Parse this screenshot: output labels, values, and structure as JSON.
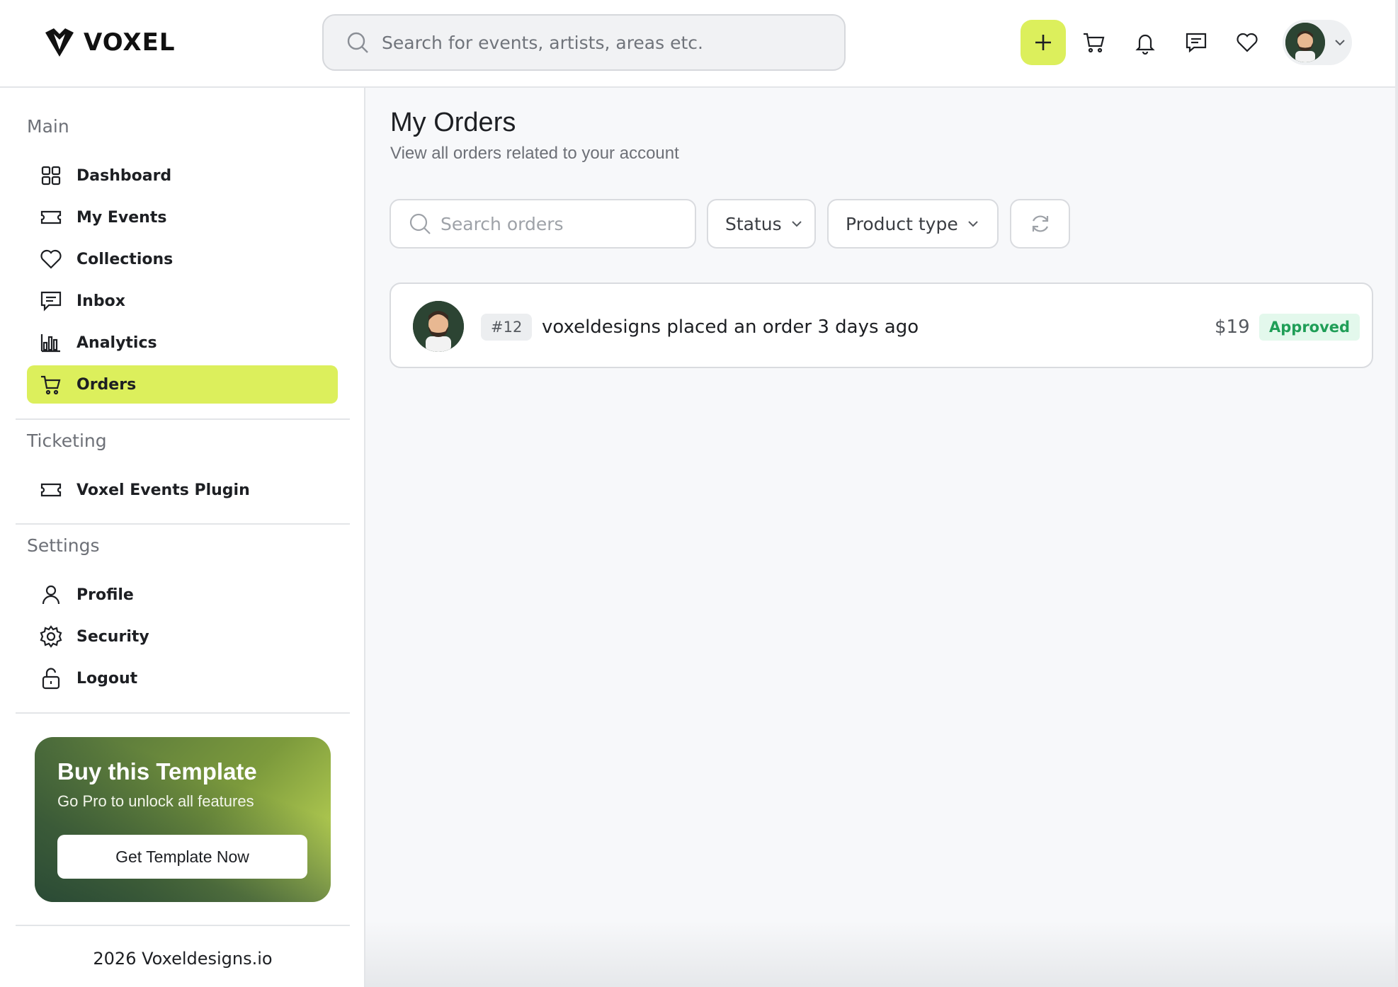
{
  "brand": {
    "name": "VOXEL"
  },
  "header": {
    "search_placeholder": "Search for events, artists, areas etc."
  },
  "sidebar": {
    "sections": {
      "main": "Main",
      "ticketing": "Ticketing",
      "settings": "Settings"
    },
    "main_items": [
      {
        "label": "Dashboard",
        "icon": "grid-icon"
      },
      {
        "label": "My Events",
        "icon": "ticket-icon"
      },
      {
        "label": "Collections",
        "icon": "heart-icon"
      },
      {
        "label": "Inbox",
        "icon": "message-icon"
      },
      {
        "label": "Analytics",
        "icon": "bar-chart-icon"
      },
      {
        "label": "Orders",
        "icon": "cart-icon",
        "active": true
      }
    ],
    "ticketing_items": [
      {
        "label": "Voxel Events Plugin",
        "icon": "ticket-icon"
      }
    ],
    "settings_items": [
      {
        "label": "Profile",
        "icon": "user-icon"
      },
      {
        "label": "Security",
        "icon": "gear-icon"
      },
      {
        "label": "Logout",
        "icon": "unlock-icon"
      }
    ],
    "promo": {
      "title": "Buy this Template",
      "subtitle": "Go Pro to unlock all features",
      "button": "Get Template Now"
    },
    "footer": "2026 Voxeldesigns.io"
  },
  "main": {
    "title": "My Orders",
    "subtitle": "View all orders related to your account",
    "filters": {
      "search_placeholder": "Search orders",
      "status_label": "Status",
      "product_type_label": "Product type"
    },
    "orders": [
      {
        "id": "#12",
        "text": "voxeldesigns placed an order 3 days ago",
        "price": "$19",
        "status": "Approved"
      }
    ]
  },
  "colors": {
    "accent": "#dcef5c",
    "approved_text": "#1f9e57",
    "approved_bg": "#e3f8ec"
  }
}
